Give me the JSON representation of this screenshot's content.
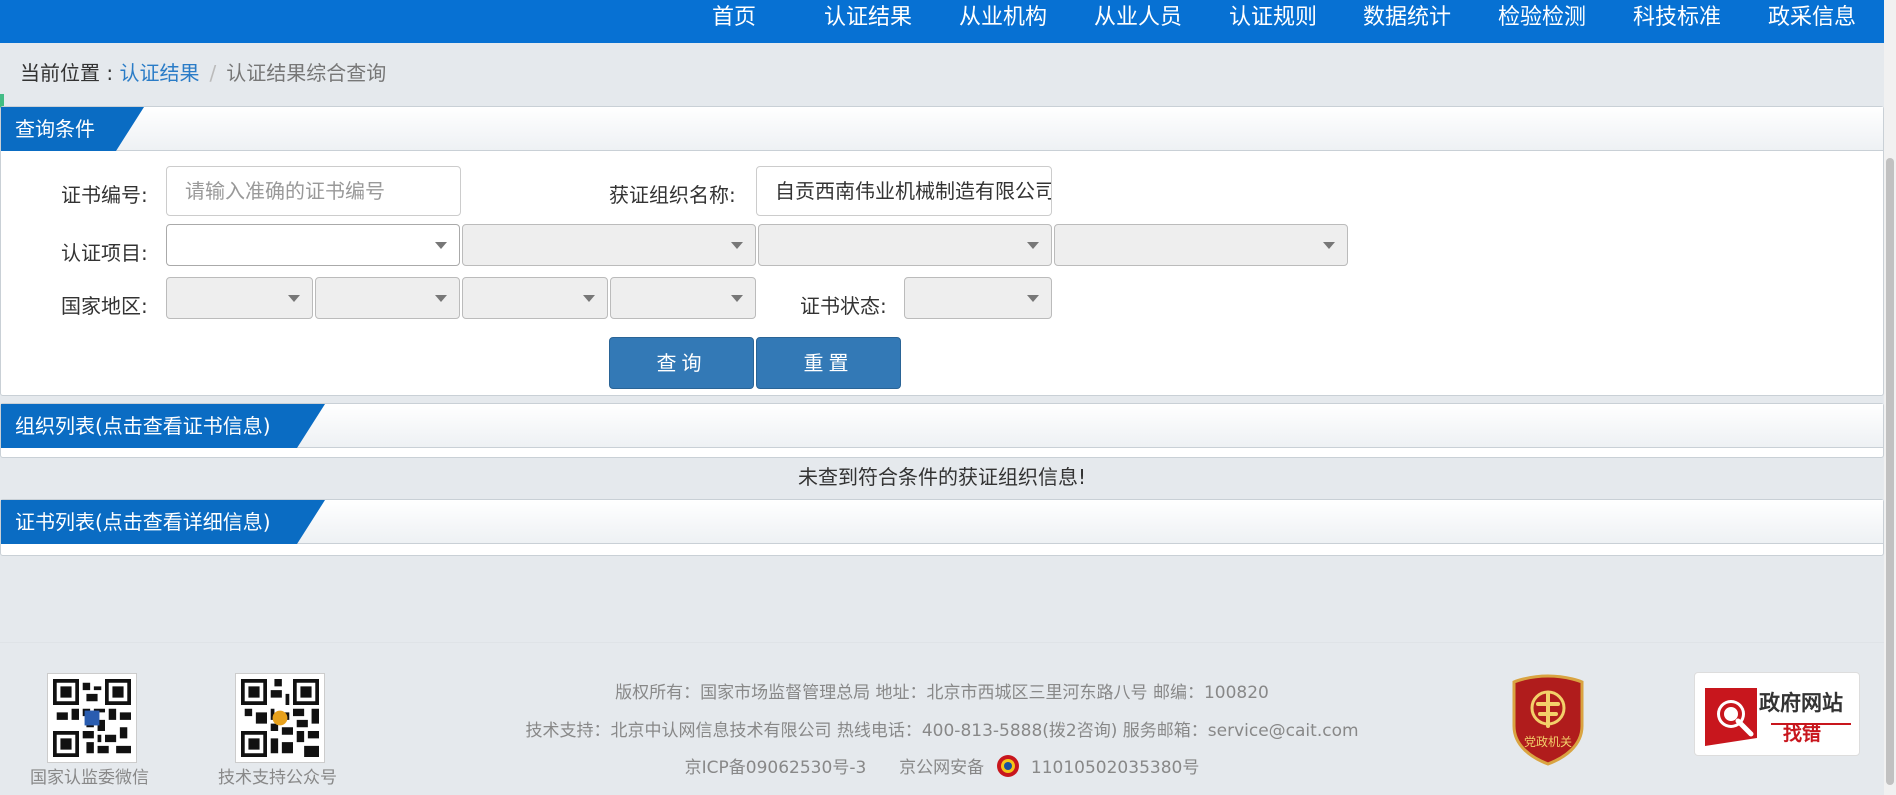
{
  "nav": {
    "items": [
      "首页",
      "认证结果",
      "从业机构",
      "从业人员",
      "认证规则",
      "数据统计",
      "检验检测",
      "科技标准",
      "政采信息"
    ]
  },
  "breadcrumb": {
    "prefix": "当前位置 : ",
    "link": "认证结果",
    "separator": "/",
    "current": "认证结果综合查询"
  },
  "query_panel": {
    "title": "查询条件",
    "cert_no_label": "证书编号:",
    "cert_no_placeholder": "请输入准确的证书编号",
    "org_name_label": "获证组织名称:",
    "org_name_value": "自贡西南伟业机械制造有限公司",
    "project_label": "认证项目:",
    "region_label": "国家地区:",
    "status_label": "证书状态:",
    "search_button": "查询",
    "reset_button": "重置"
  },
  "org_list": {
    "title": "组织列表(点击查看证书信息)",
    "empty_message": "未查到符合条件的获证组织信息!"
  },
  "cert_list": {
    "title": "证书列表(点击查看详细信息)"
  },
  "footer": {
    "qr1_label": "国家认监委微信",
    "qr2_label": "技术支持公众号",
    "line1": "版权所有：国家市场监督管理总局    地址：北京市西城区三里河东路八号    邮编：100820",
    "line2": "技术支持：北京中认网信息技术有限公司    热线电话：400-813-5888(拨2咨询)    服务邮箱：service@cait.com",
    "icp": "京ICP备09062530号-3",
    "police_prefix": "京公网安备",
    "police_no": "11010502035380号",
    "badge_text": "党政机关",
    "gov_title": "政府网站",
    "gov_sub": "找错"
  }
}
